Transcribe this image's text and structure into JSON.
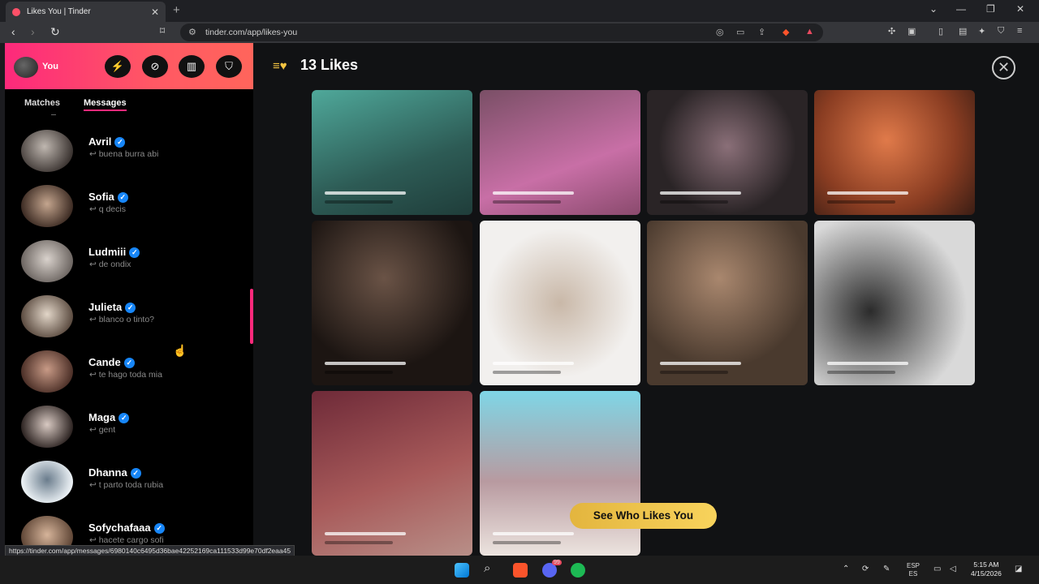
{
  "browser": {
    "tab_title": "Likes You | Tinder",
    "url": "tinder.com/app/likes-you",
    "status_url": "https://tinder.com/app/messages/6980140c6495d36bae42252169ca111533d99e70df2eaa45"
  },
  "sidebar": {
    "me_label": "You",
    "tabs": {
      "matches": "Matches",
      "messages": "Messages"
    },
    "messages": [
      {
        "name": "Avril",
        "last": "↩ buena burra abi"
      },
      {
        "name": "Sofia",
        "last": "↩ q decis"
      },
      {
        "name": "Ludmiii",
        "last": "↩ de ondix"
      },
      {
        "name": "Julieta",
        "last": "↩ blanco o tinto?"
      },
      {
        "name": "Cande",
        "last": "↩ te hago toda mia"
      },
      {
        "name": "Maga",
        "last": "↩ gent"
      },
      {
        "name": "Dhanna",
        "last": "↩ t parto toda rubia"
      },
      {
        "name": "Sofychafaaa",
        "last": "↩ hacete cargo sofi"
      }
    ]
  },
  "main": {
    "title": "13 Likes",
    "cta": "See Who Likes You",
    "cards": [
      {
        "bg": "linear-gradient(160deg,#4fa89a,#2d5b55 60%,#1f3d3a)"
      },
      {
        "bg": "linear-gradient(160deg,#7a4f66,#c86fa6 60%,#8a4a6d)"
      },
      {
        "bg": "radial-gradient(circle at 50% 45%,#8a6f78,#2a2426 65%)"
      },
      {
        "bg": "radial-gradient(circle at 45% 40%,#e07a4a,#8a3d22 60%,#3a1d14)"
      },
      {
        "bg": "radial-gradient(circle at 45% 35%,#6a5346,#1c1512 65%)"
      },
      {
        "bg": "radial-gradient(circle at 50% 50%,#c9b8a8,#f2f0ee 65%)"
      },
      {
        "bg": "radial-gradient(circle at 45% 35%,#a9876e,#4a3a2e 65%)"
      },
      {
        "bg": "radial-gradient(circle at 35% 55%,#2b2b2b,#d9d9d9 70%)"
      },
      {
        "bg": "linear-gradient(160deg,#6e2a38,#a85a5a 55%,#b88f88)"
      },
      {
        "bg": "linear-gradient(180deg,#7fd6e6,#b89aa0 55%,#ece4df)"
      }
    ]
  },
  "taskbar": {
    "lang": "ESP",
    "lang2": "ES",
    "time": "5:15 AM",
    "date": "4/15/2026",
    "notif_count": "99"
  }
}
